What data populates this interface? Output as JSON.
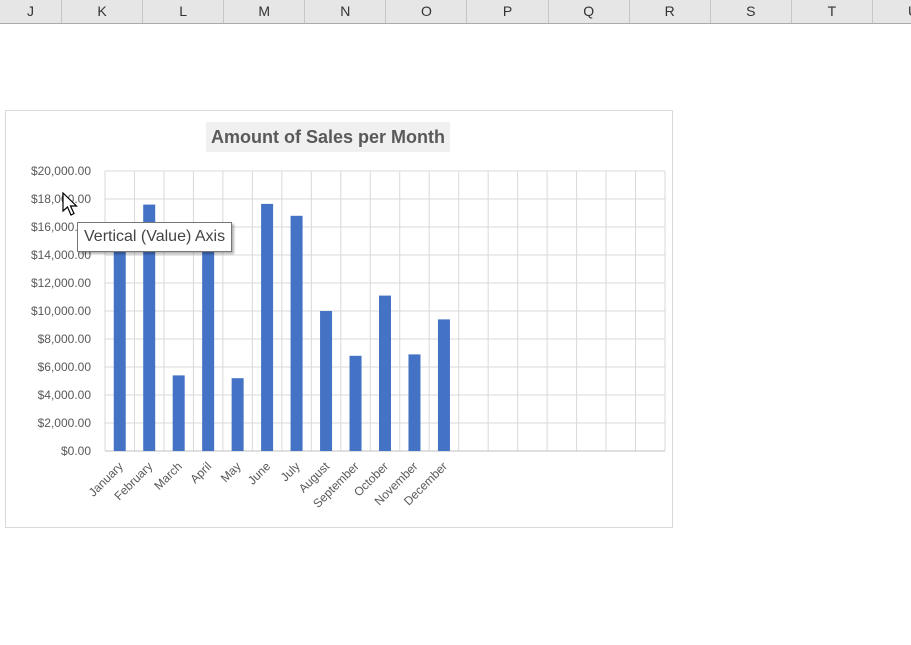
{
  "spreadsheet": {
    "column_headers": [
      "J",
      "K",
      "L",
      "M",
      "N",
      "O",
      "P",
      "Q",
      "R",
      "S",
      "T",
      "U"
    ]
  },
  "tooltip": {
    "text": "Vertical (Value) Axis"
  },
  "colors": {
    "bar": "#4472c4",
    "grid": "#d9d9d9",
    "axis_text": "#595959"
  },
  "chart_data": {
    "type": "bar",
    "title": "Amount of Sales per Month",
    "xlabel": "",
    "ylabel": "",
    "categories": [
      "January",
      "February",
      "March",
      "April",
      "May",
      "June",
      "July",
      "August",
      "September",
      "October",
      "November",
      "December"
    ],
    "values": [
      15000,
      17600,
      5400,
      15500,
      5200,
      17650,
      16800,
      10000,
      6800,
      11100,
      6900,
      9400
    ],
    "ylim": [
      0,
      20000
    ],
    "yticks": [
      0,
      2000,
      4000,
      6000,
      8000,
      10000,
      12000,
      14000,
      16000,
      18000,
      20000
    ],
    "ytick_labels": [
      "$0.00",
      "$2,000.00",
      "$4,000.00",
      "$6,000.00",
      "$8,000.00",
      "$10,000.00",
      "$12,000.00",
      "$14,000.00",
      "$16,000.00",
      "$18,000.00",
      "$20,000.00"
    ],
    "grid": true,
    "legend": "none"
  }
}
